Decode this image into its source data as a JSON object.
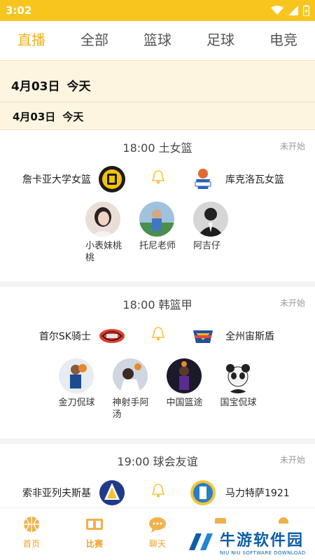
{
  "status": {
    "time": "3:02"
  },
  "tabs": [
    "直播",
    "全部",
    "篮球",
    "足球",
    "电竞"
  ],
  "date_header": {
    "date": "4月03日",
    "label": "今天"
  },
  "date_sub": {
    "date": "4月03日",
    "label": "今天"
  },
  "matches": [
    {
      "time_league": "18:00  土女篮",
      "status": "未开始",
      "home": "詹卡亚大学女篮",
      "away": "库克洛瓦女篮",
      "anchors": [
        "小表妹桃桃",
        "托尼老师",
        "阿吉仔"
      ]
    },
    {
      "time_league": "18:00  韩篮甲",
      "status": "未开始",
      "home": "首尔SK骑士",
      "away": "全州宙斯盾",
      "anchors": [
        "金刀侃球",
        "神射手阿汤",
        "中国篮途",
        "国宝侃球"
      ]
    },
    {
      "time_league": "19:00  球会友谊",
      "status": "未开始",
      "home": "索非亚列夫斯基",
      "away": "马力特萨1921",
      "anchors": []
    }
  ],
  "bottom_nav": [
    "首页",
    "比赛",
    "聊天"
  ],
  "watermark": {
    "cn": "牛游软件园",
    "en": "NIU NIU SOFTWARE DOWNLOAD"
  },
  "colors": {
    "accent": "#f2b21c",
    "status_bar": "#f7c51e",
    "date_bg": "#fdf5e0"
  }
}
